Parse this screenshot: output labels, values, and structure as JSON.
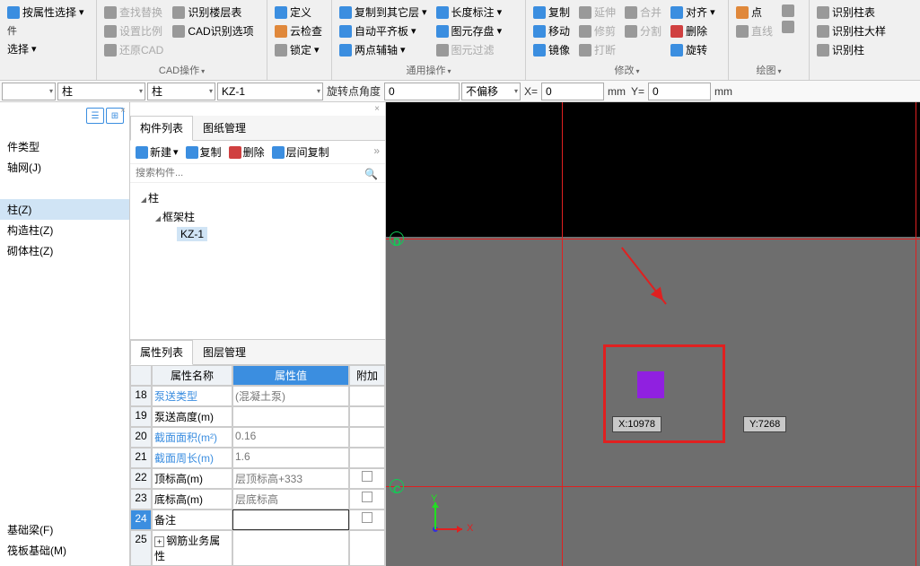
{
  "ribbon": {
    "groups": [
      {
        "label": "件",
        "items": [
          [
            "按属性选择",
            "ico-blue"
          ]
        ]
      },
      {
        "label": "选择",
        "suffix": "▾",
        "items": []
      },
      {
        "label": "CAD操作",
        "items": [
          [
            "查找替换",
            "ico-gray",
            true
          ],
          [
            "设置比例",
            "ico-gray",
            true
          ],
          [
            "还原CAD",
            "ico-gray",
            true
          ],
          [
            "识别楼层表",
            "ico-gray"
          ],
          [
            "CAD识别选项",
            "ico-gray"
          ]
        ]
      },
      {
        "label": "",
        "items": [
          [
            "定义",
            "ico-blue"
          ],
          [
            "云检查",
            "ico-orange"
          ],
          [
            "锁定",
            "ico-gray"
          ]
        ]
      },
      {
        "label": "通用操作",
        "items": [
          [
            "复制到其它层",
            "ico-blue"
          ],
          [
            "自动平齐板",
            "ico-blue"
          ],
          [
            "两点辅轴",
            "ico-blue"
          ],
          [
            "长度标注",
            "ico-blue"
          ],
          [
            "图元存盘",
            "ico-blue"
          ],
          [
            "图元过滤",
            "ico-gray",
            true
          ]
        ]
      },
      {
        "label": "修改",
        "items": [
          [
            "复制",
            "ico-blue"
          ],
          [
            "移动",
            "ico-blue"
          ],
          [
            "镜像",
            "ico-blue"
          ],
          [
            "延伸",
            "ico-gray",
            true
          ],
          [
            "修剪",
            "ico-gray",
            true
          ],
          [
            "打断",
            "ico-gray",
            true
          ],
          [
            "合并",
            "ico-gray",
            true
          ],
          [
            "分割",
            "ico-gray",
            true
          ],
          [
            "对齐",
            "ico-blue"
          ],
          [
            "删除",
            "ico-red"
          ],
          [
            "旋转",
            "ico-blue"
          ]
        ]
      },
      {
        "label": "绘图",
        "items": [
          [
            "点",
            "ico-orange"
          ],
          [
            "直线",
            "ico-gray",
            true
          ],
          [
            "",
            "ico-gray",
            true
          ],
          [
            "",
            "ico-gray",
            true
          ]
        ]
      },
      {
        "label": "",
        "items": [
          [
            "识别柱表",
            "ico-gray"
          ],
          [
            "识别柱大样",
            "ico-gray"
          ],
          [
            "识别柱",
            "ico-gray"
          ]
        ]
      }
    ]
  },
  "inputbar": {
    "combo1": "柱",
    "combo2": "柱",
    "combo3": "KZ-1",
    "spin_label": "旋转点角度",
    "spin_val": "0",
    "offset": "不偏移",
    "x_lbl": "X=",
    "x_val": "0",
    "sep": "mm",
    "y_lbl": "Y=",
    "y_val": "0",
    "unit": "mm"
  },
  "leftnav": {
    "items": [
      "件类型",
      "轴网(J)",
      "",
      "柱(Z)",
      "构造柱(Z)",
      "砌体柱(Z)",
      "",
      "",
      "",
      "",
      "",
      "",
      "",
      "",
      "",
      "",
      "",
      "",
      "基础梁(F)",
      "筏板基础(M)"
    ],
    "sel": 3
  },
  "midpane": {
    "tabs": [
      "构件列表",
      "图纸管理"
    ],
    "toolbar": [
      "新建",
      "复制",
      "删除",
      "层间复制"
    ],
    "search_ph": "搜索构件...",
    "tree": [
      {
        "lv": 1,
        "exp": "◢",
        "label": "柱"
      },
      {
        "lv": 2,
        "exp": "◢",
        "label": "框架柱"
      },
      {
        "lv": 3,
        "exp": "",
        "label": "KZ-1",
        "sel": true
      }
    ],
    "proptabs": [
      "属性列表",
      "图层管理"
    ],
    "propheaders": [
      "",
      "属性名称",
      "属性值",
      "附加"
    ],
    "proprows": [
      {
        "n": "18",
        "name": "泵送类型",
        "val": "(混凝土泵)",
        "link": true,
        "chk": false
      },
      {
        "n": "19",
        "name": "泵送高度(m)",
        "val": "",
        "link": false,
        "chk": false
      },
      {
        "n": "20",
        "name": "截面面积(m²)",
        "val": "0.16",
        "link": true,
        "chk": false
      },
      {
        "n": "21",
        "name": "截面周长(m)",
        "val": "1.6",
        "link": true,
        "chk": false
      },
      {
        "n": "22",
        "name": "顶标高(m)",
        "val": "层顶标高+333",
        "link": false,
        "chk": true,
        "hl": true
      },
      {
        "n": "23",
        "name": "底标高(m)",
        "val": "层底标高",
        "link": false,
        "chk": true
      },
      {
        "n": "24",
        "name": "备注",
        "val": "",
        "link": false,
        "chk": true,
        "sel": true
      },
      {
        "n": "25",
        "name": "钢筋业务属性",
        "val": "",
        "link": false,
        "chk": false,
        "exp": "+"
      }
    ]
  },
  "viewport": {
    "labelD": "D",
    "labelC": "C",
    "coordX": "X:10978",
    "coordY": "Y:7268",
    "axisX": "X",
    "axisY": "Y"
  }
}
